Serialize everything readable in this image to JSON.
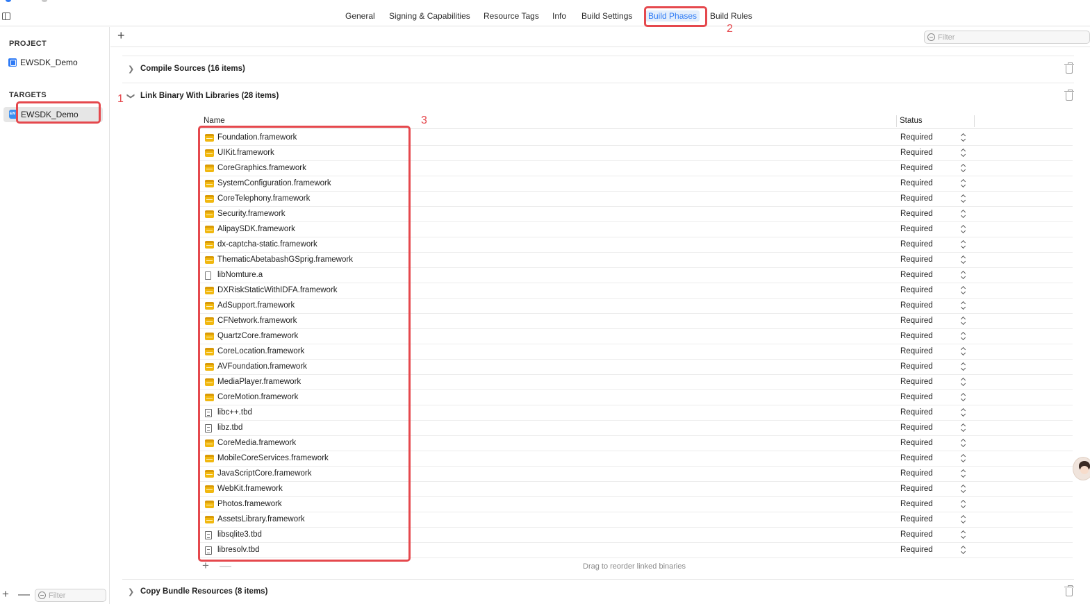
{
  "tabs": [
    {
      "label": "General",
      "active": false
    },
    {
      "label": "Signing & Capabilities",
      "active": false
    },
    {
      "label": "Resource Tags",
      "active": false
    },
    {
      "label": "Info",
      "active": false
    },
    {
      "label": "Build Settings",
      "active": false
    },
    {
      "label": "Build Phases",
      "active": true
    },
    {
      "label": "Build Rules",
      "active": false
    }
  ],
  "sidebar": {
    "project_heading": "PROJECT",
    "project_name": "EWSDK_Demo",
    "targets_heading": "TARGETS",
    "target_name": "EWSDK_Demo",
    "add": "+",
    "remove": "—",
    "filter_placeholder": "Filter"
  },
  "toolbar": {
    "add": "+",
    "filter_placeholder": "Filter"
  },
  "phases": {
    "compile_sources": "Compile Sources (16 items)",
    "link_binary": "Link Binary With Libraries (28 items)",
    "copy_bundle": "Copy Bundle Resources (8 items)"
  },
  "table": {
    "col_name": "Name",
    "col_status": "Status",
    "rows": [
      {
        "name": "Foundation.framework",
        "status": "Required",
        "icon": "framework-icon"
      },
      {
        "name": "UIKit.framework",
        "status": "Required",
        "icon": "framework-icon"
      },
      {
        "name": "CoreGraphics.framework",
        "status": "Required",
        "icon": "framework-icon"
      },
      {
        "name": "SystemConfiguration.framework",
        "status": "Required",
        "icon": "framework-icon"
      },
      {
        "name": "CoreTelephony.framework",
        "status": "Required",
        "icon": "framework-icon"
      },
      {
        "name": "Security.framework",
        "status": "Required",
        "icon": "framework-icon"
      },
      {
        "name": "AlipaySDK.framework",
        "status": "Required",
        "icon": "framework-icon"
      },
      {
        "name": "dx-captcha-static.framework",
        "status": "Required",
        "icon": "framework-icon"
      },
      {
        "name": "ThematicAbetabashGSprig.framework",
        "status": "Required",
        "icon": "framework-icon"
      },
      {
        "name": "libNomture.a",
        "status": "Required",
        "icon": "document-icon"
      },
      {
        "name": "DXRiskStaticWithIDFA.framework",
        "status": "Required",
        "icon": "framework-icon"
      },
      {
        "name": "AdSupport.framework",
        "status": "Required",
        "icon": "framework-icon"
      },
      {
        "name": "CFNetwork.framework",
        "status": "Required",
        "icon": "framework-icon"
      },
      {
        "name": "QuartzCore.framework",
        "status": "Required",
        "icon": "framework-icon"
      },
      {
        "name": "CoreLocation.framework",
        "status": "Required",
        "icon": "framework-icon"
      },
      {
        "name": "AVFoundation.framework",
        "status": "Required",
        "icon": "framework-icon"
      },
      {
        "name": "MediaPlayer.framework",
        "status": "Required",
        "icon": "framework-icon"
      },
      {
        "name": "CoreMotion.framework",
        "status": "Required",
        "icon": "framework-icon"
      },
      {
        "name": "libc++.tbd",
        "status": "Required",
        "icon": "tbd-icon"
      },
      {
        "name": "libz.tbd",
        "status": "Required",
        "icon": "tbd-icon"
      },
      {
        "name": "CoreMedia.framework",
        "status": "Required",
        "icon": "framework-icon"
      },
      {
        "name": "MobileCoreServices.framework",
        "status": "Required",
        "icon": "framework-icon"
      },
      {
        "name": "JavaScriptCore.framework",
        "status": "Required",
        "icon": "framework-icon"
      },
      {
        "name": "WebKit.framework",
        "status": "Required",
        "icon": "framework-icon"
      },
      {
        "name": "Photos.framework",
        "status": "Required",
        "icon": "framework-icon"
      },
      {
        "name": "AssetsLibrary.framework",
        "status": "Required",
        "icon": "framework-icon"
      },
      {
        "name": "libsqlite3.tbd",
        "status": "Required",
        "icon": "tbd-icon"
      },
      {
        "name": "libresolv.tbd",
        "status": "Required",
        "icon": "tbd-icon"
      }
    ],
    "footer_add": "+",
    "footer_remove": "—",
    "drag_hint": "Drag to reorder linked binaries"
  },
  "annotations": {
    "n1": "1",
    "n2": "2",
    "n3": "3"
  },
  "colors": {
    "accent": "#2f7bf5",
    "annotation": "#e5484d",
    "framework": "#f1b80f"
  }
}
